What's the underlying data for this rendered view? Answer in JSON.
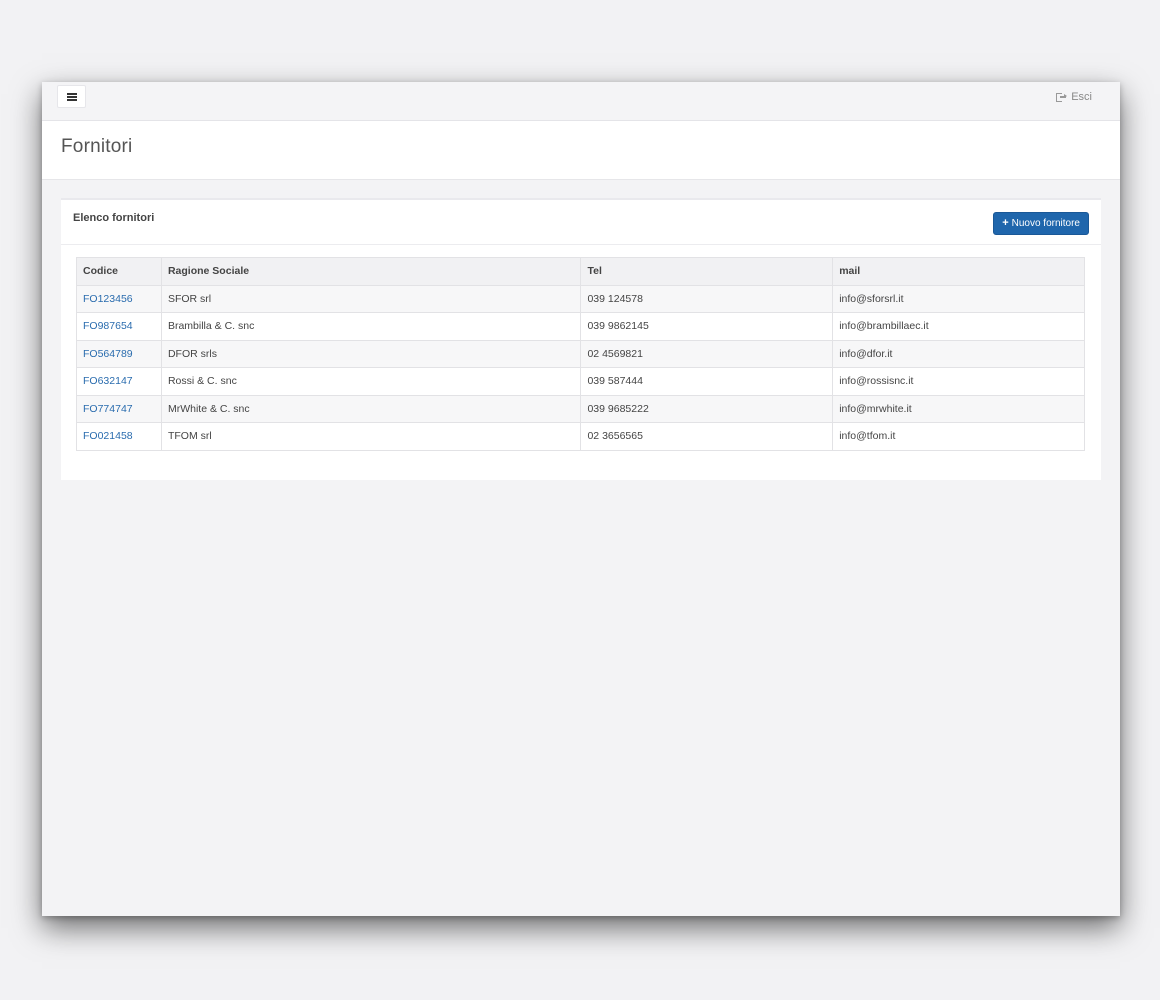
{
  "topbar": {
    "menu_icon": "hamburger-icon",
    "logout_icon": "sign-out-icon",
    "logout_label": "Esci"
  },
  "page": {
    "title": "Fornitori"
  },
  "panel": {
    "title": "Elenco fornitori",
    "new_button_label": "Nuovo fornitore",
    "new_button_icon": "plus-icon",
    "accent_color": "#1f66ac"
  },
  "table": {
    "headers": [
      "Codice",
      "Ragione Sociale",
      "Tel",
      "mail"
    ],
    "rows": [
      [
        "FO123456",
        "SFOR srl",
        "039 124578",
        "info@sforsrl.it"
      ],
      [
        "FO987654",
        "Brambilla & C. snc",
        "039 9862145",
        "info@brambillaec.it"
      ],
      [
        "FO564789",
        "DFOR srls",
        "02 4569821",
        "info@dfor.it"
      ],
      [
        "FO632147",
        "Rossi & C. snc",
        "039 587444",
        "info@rossisnc.it"
      ],
      [
        "FO774747",
        "MrWhite & C. snc",
        "039 9685222",
        "info@mrwhite.it"
      ],
      [
        "FO021458",
        "TFOM srl",
        "02 3656565",
        "info@tfom.it"
      ]
    ]
  }
}
